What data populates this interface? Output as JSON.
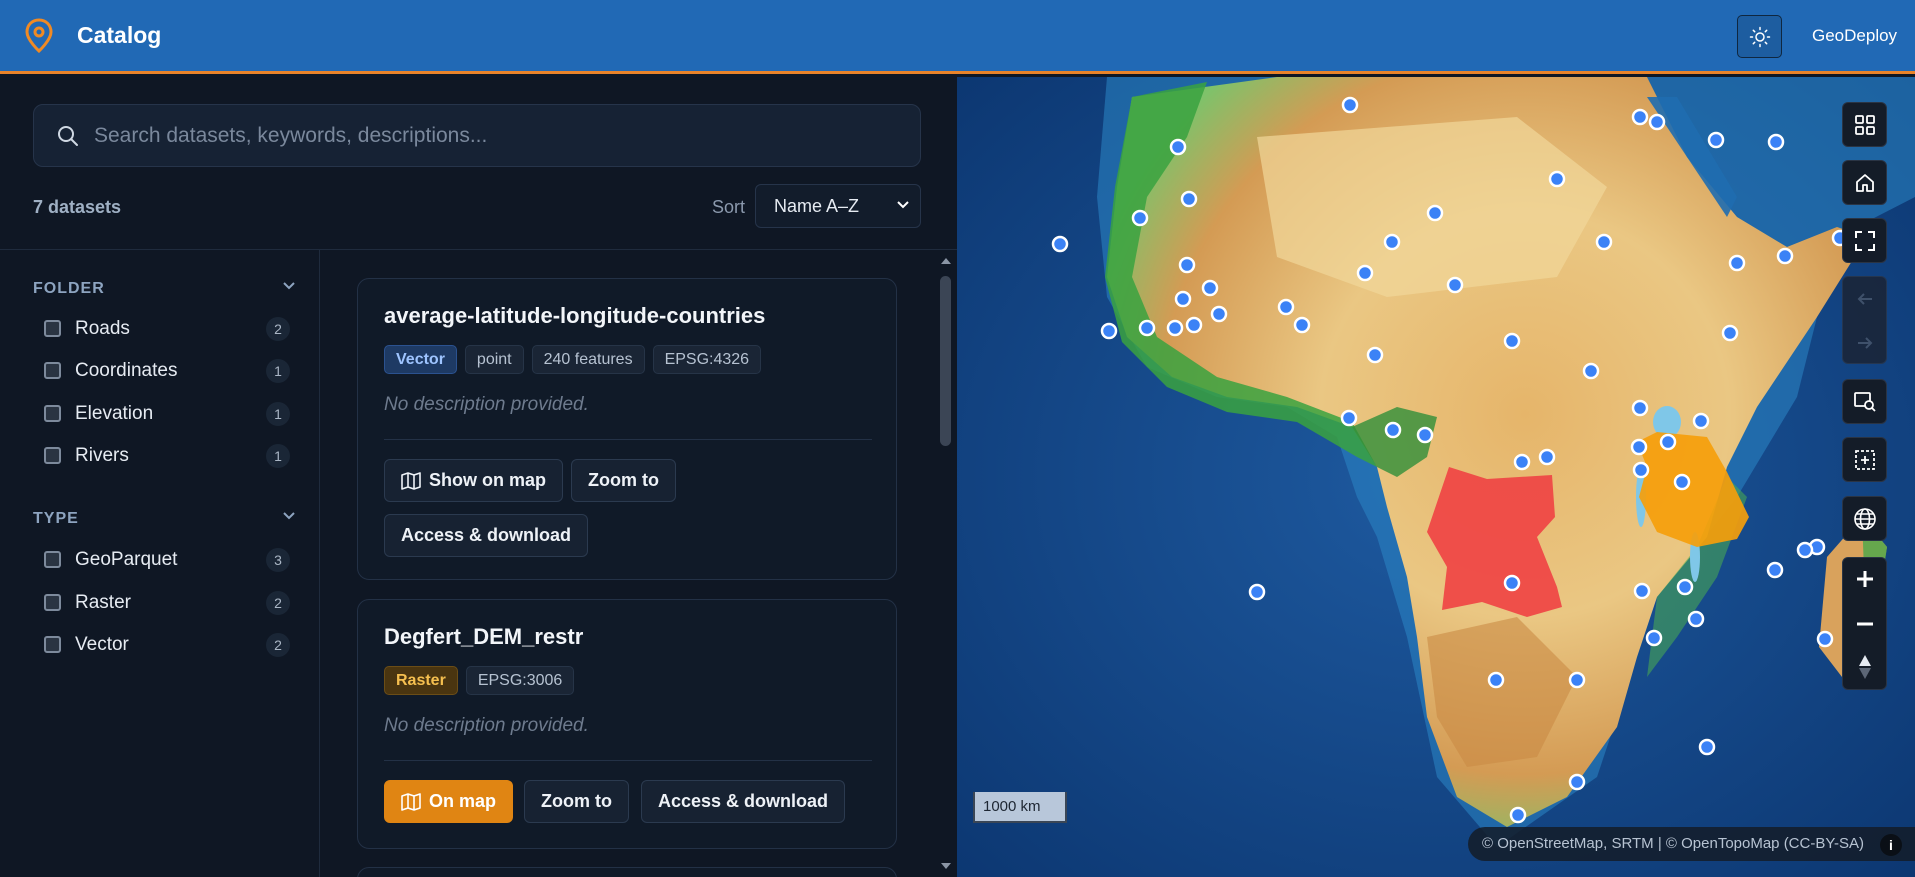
{
  "header": {
    "title": "Catalog",
    "brand": "GeoDeploy",
    "logo_icon": "map-pin-icon",
    "theme_icon": "sun-icon",
    "accent_color": "#e8832a",
    "bar_color": "#2169b5"
  },
  "search": {
    "placeholder": "Search datasets, keywords, descriptions..."
  },
  "results": {
    "count_label": "7 datasets",
    "sort_label": "Sort",
    "sort_value": "Name A–Z"
  },
  "filters": {
    "folder": {
      "title": "FOLDER",
      "items": [
        {
          "label": "Roads",
          "count": "2"
        },
        {
          "label": "Coordinates",
          "count": "1"
        },
        {
          "label": "Elevation",
          "count": "1"
        },
        {
          "label": "Rivers",
          "count": "1"
        }
      ]
    },
    "type": {
      "title": "TYPE",
      "items": [
        {
          "label": "GeoParquet",
          "count": "3"
        },
        {
          "label": "Raster",
          "count": "2"
        },
        {
          "label": "Vector",
          "count": "2"
        }
      ]
    }
  },
  "cards": [
    {
      "title": "average-latitude-longitude-countries",
      "tags": [
        "Vector",
        "point",
        "240 features",
        "EPSG:4326"
      ],
      "description": "No description provided.",
      "buttons": {
        "map": "Show on map",
        "zoom": "Zoom to",
        "access": "Access & download"
      }
    },
    {
      "title": "Degfert_DEM_restr",
      "tags": [
        "Raster",
        "EPSG:3006"
      ],
      "description": "No description provided.",
      "buttons": {
        "map": "On map",
        "zoom": "Zoom to",
        "access": "Access & download"
      }
    }
  ],
  "map": {
    "scale": "1000 km",
    "attribution": "© OpenStreetMap, SRTM | © OpenTopoMap (CC-BY-SA)",
    "info": "i",
    "controls": [
      "grid-icon",
      "home-icon",
      "fullscreen-icon",
      "back-icon",
      "forward-icon",
      "zoom-to-layer-icon",
      "select-area-icon",
      "globe-icon",
      "zoom-in-icon",
      "zoom-out-icon",
      "compass-icon"
    ],
    "colors": {
      "point": "#3b82f6",
      "polygon_red": "#ef4444",
      "polygon_orange": "#f59e0b"
    }
  }
}
